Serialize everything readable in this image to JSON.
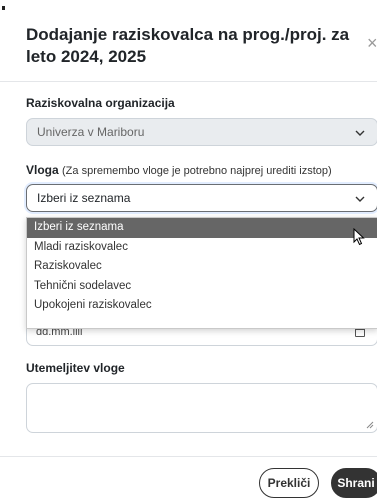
{
  "modal": {
    "title": "Dodajanje raziskovalca na prog./proj. za leto 2024, 2025",
    "close_symbol": "×"
  },
  "form": {
    "org_label": "Raziskovalna organizacija",
    "org_value": "Univerza v Mariboru",
    "role_label": "Vloga",
    "role_hint": "(Za spremembo vloge je potrebno najprej urediti izstop)",
    "role_value": "Izberi iz seznama",
    "date_placeholder": "dd.mm.llll",
    "justification_label": "Utemeljitev vloge",
    "justification_value": ""
  },
  "dropdown": {
    "options": [
      "Izberi iz seznama",
      "Mladi raziskovalec",
      "Raziskovalec",
      "Tehnični sodelavec",
      "Upokojeni raziskovalec"
    ],
    "selected_index": 0
  },
  "footer": {
    "cancel_label": "Prekliči",
    "save_label": "Shrani"
  },
  "icons": {
    "close": "close-icon",
    "chevron": "chevron-down-icon",
    "calendar": "calendar-icon",
    "cursor": "mouse-cursor-icon",
    "resize": "resize-grip-icon"
  },
  "colors": {
    "highlight": "#666666",
    "save_button": "#333333",
    "disabled_bg": "#e9ecef"
  }
}
